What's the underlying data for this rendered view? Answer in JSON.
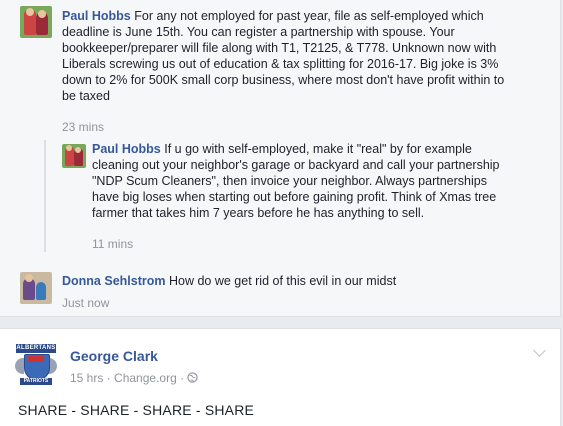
{
  "comments": [
    {
      "author": "Paul Hobbs",
      "lines": [
        "For any not employed for past year, file as self-employed which",
        "deadline is June 15th. You can register a partnership with spouse. Your",
        "bookkeeper/preparer will file along with T1, T2125, & T778. Unknown now with",
        "Liberals screwing us out of education & tax splitting for 2016-17. Big joke is 3%",
        "down to 2% for 500K small corp business, where most don't have profit within to",
        "be taxed"
      ],
      "time": "23 mins"
    },
    {
      "author": "Paul Hobbs",
      "lines": [
        "If u go with self-employed, make it \"real\" by for example",
        "cleaning out your neighbor's garage or backyard and call your partnership",
        "\"NDP Scum Cleaners\", then invoice your neighbor. Always partnerships",
        "have big loses when starting out before gaining profit. Think of Xmas tree",
        "farmer that takes him 7 years before he has anything to sell."
      ],
      "time": "11 mins"
    },
    {
      "author": "Donna Sehlstrom",
      "lines": [
        "How do we get rid of this evil in our midst"
      ],
      "time": "Just now"
    }
  ],
  "post": {
    "author": "George Clark",
    "time": "15 hrs",
    "separator": "·",
    "source": "Change.org",
    "text": "SHARE - SHARE - SHARE - SHARE",
    "logo_top": "ALBERTANS",
    "logo_bottom": "PATRIOTS"
  }
}
